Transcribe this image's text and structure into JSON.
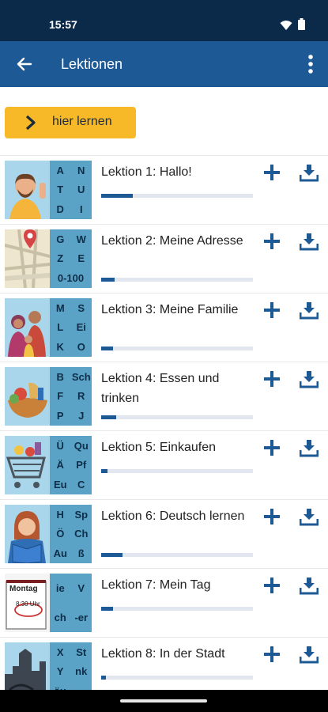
{
  "status_bar": {
    "time": "15:57",
    "icons": [
      "wifi-icon",
      "battery-icon"
    ]
  },
  "app_bar": {
    "title": "Lektionen",
    "back_icon": "arrow-left-icon",
    "menu_icon": "more-vertical-icon"
  },
  "learn_button": {
    "label": "hier lernen",
    "icon": "chevron-right-icon",
    "color": "#f7b928"
  },
  "colors": {
    "primary": "#1d5a95",
    "letters_bg": "#5aa3c6",
    "progress_track": "#e2e6ee"
  },
  "lessons": [
    {
      "title": "Lektion 1: Hallo!",
      "letters": [
        "A",
        "N",
        "T",
        "U",
        "D",
        "I"
      ],
      "progress": 0.21
    },
    {
      "title": "Lektion 2: Meine Adresse",
      "letters": [
        "G",
        "W",
        "Z",
        "E",
        "0-100",
        ""
      ],
      "progress": 0.09
    },
    {
      "title": "Lektion 3: Meine Familie",
      "letters": [
        "M",
        "S",
        "L",
        "Ei",
        "K",
        "O"
      ],
      "progress": 0.08
    },
    {
      "title": "Lektion 4: Essen und trinken",
      "letters": [
        "B",
        "Sch",
        "F",
        "R",
        "P",
        "J"
      ],
      "progress": 0.1
    },
    {
      "title": "Lektion 5: Einkaufen",
      "letters": [
        "Ü",
        "Qu",
        "Ä",
        "Pf",
        "Eu",
        "C"
      ],
      "progress": 0.04
    },
    {
      "title": "Lektion 6: Deutsch lernen",
      "letters": [
        "H",
        "Sp",
        "Ö",
        "Ch",
        "Au",
        "ß"
      ],
      "progress": 0.14
    },
    {
      "title": "Lektion 7: Mein Tag",
      "letters": [
        "ie",
        "V",
        "ch",
        "-er",
        "",
        ""
      ],
      "progress": 0.08
    },
    {
      "title": "Lektion 8: In der Stadt",
      "letters": [
        "X",
        "St",
        "Y",
        "nk",
        "äu",
        ""
      ],
      "progress": 0.03
    }
  ],
  "thumb_texts": {
    "lesson7_sign": "Montag",
    "lesson7_time": "8:30 Uhr"
  },
  "row_icons": {
    "add": "plus-icon",
    "download": "download-icon"
  }
}
